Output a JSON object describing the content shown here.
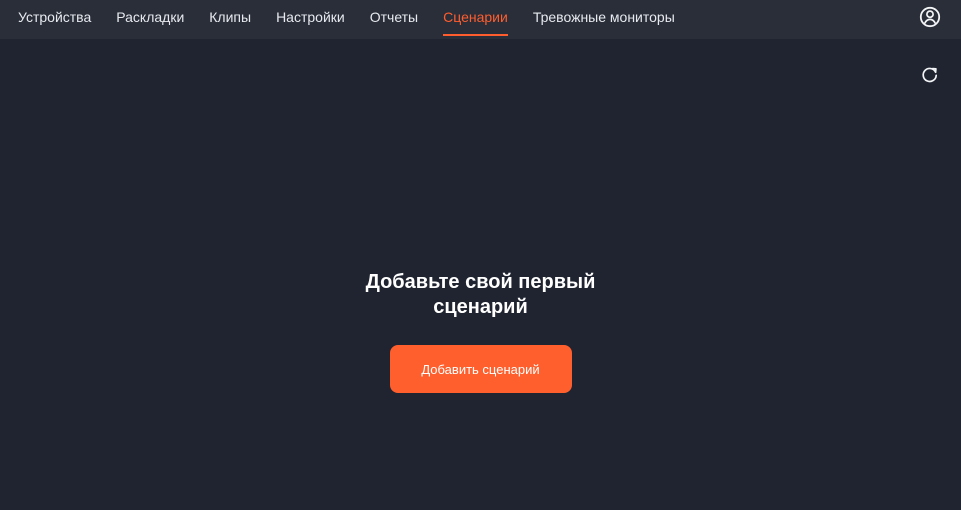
{
  "nav": {
    "items": [
      {
        "label": "Устройства",
        "active": false
      },
      {
        "label": "Раскладки",
        "active": false
      },
      {
        "label": "Клипы",
        "active": false
      },
      {
        "label": "Настройки",
        "active": false
      },
      {
        "label": "Отчеты",
        "active": false
      },
      {
        "label": "Сценарии",
        "active": true
      },
      {
        "label": "Тревожные мониторы",
        "active": false
      }
    ]
  },
  "header": {
    "profile_icon": "user-circle-icon"
  },
  "toolbar": {
    "refresh_icon": "refresh-icon"
  },
  "empty_state": {
    "title": "Добавьте свой первый сценарий",
    "button_label": "Добавить сценарий"
  },
  "colors": {
    "background": "#1f2430",
    "topbar": "#292e39",
    "accent": "#ff5d2e",
    "text": "#e7e9ee"
  }
}
